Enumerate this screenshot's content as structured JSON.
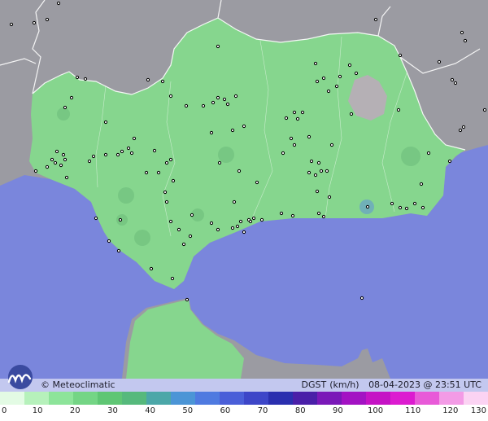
{
  "map": {
    "brand": "© Meteoclimatic",
    "variable": "DGST",
    "unit": "(km/h)",
    "timestamp": "08-04-2023 @ 23:51 UTC",
    "colors": {
      "sea": "#7a86dc",
      "land_foreign": "#9a9aa0",
      "land_region": "#86d68e",
      "land_region_dark": "#78c882",
      "border": "#ffffff",
      "station": "#000000"
    },
    "scale_ticks": [
      "0",
      "10",
      "20",
      "30",
      "40",
      "50",
      "60",
      "70",
      "80",
      "90",
      "100",
      "110",
      "120",
      "130"
    ],
    "scale_colors": [
      "#e3fbe4",
      "#b6f1bb",
      "#8de49a",
      "#74d585",
      "#5fc674",
      "#56b97c",
      "#4ba7a8",
      "#4b95d6",
      "#4f7ae0",
      "#4a5fd8",
      "#3d46c8",
      "#2a2faf",
      "#4a1fa8",
      "#7a18b8",
      "#a312c3",
      "#c512c5",
      "#dc1bd0",
      "#e85ad8",
      "#f39be6",
      "#fbd3f3"
    ]
  }
}
